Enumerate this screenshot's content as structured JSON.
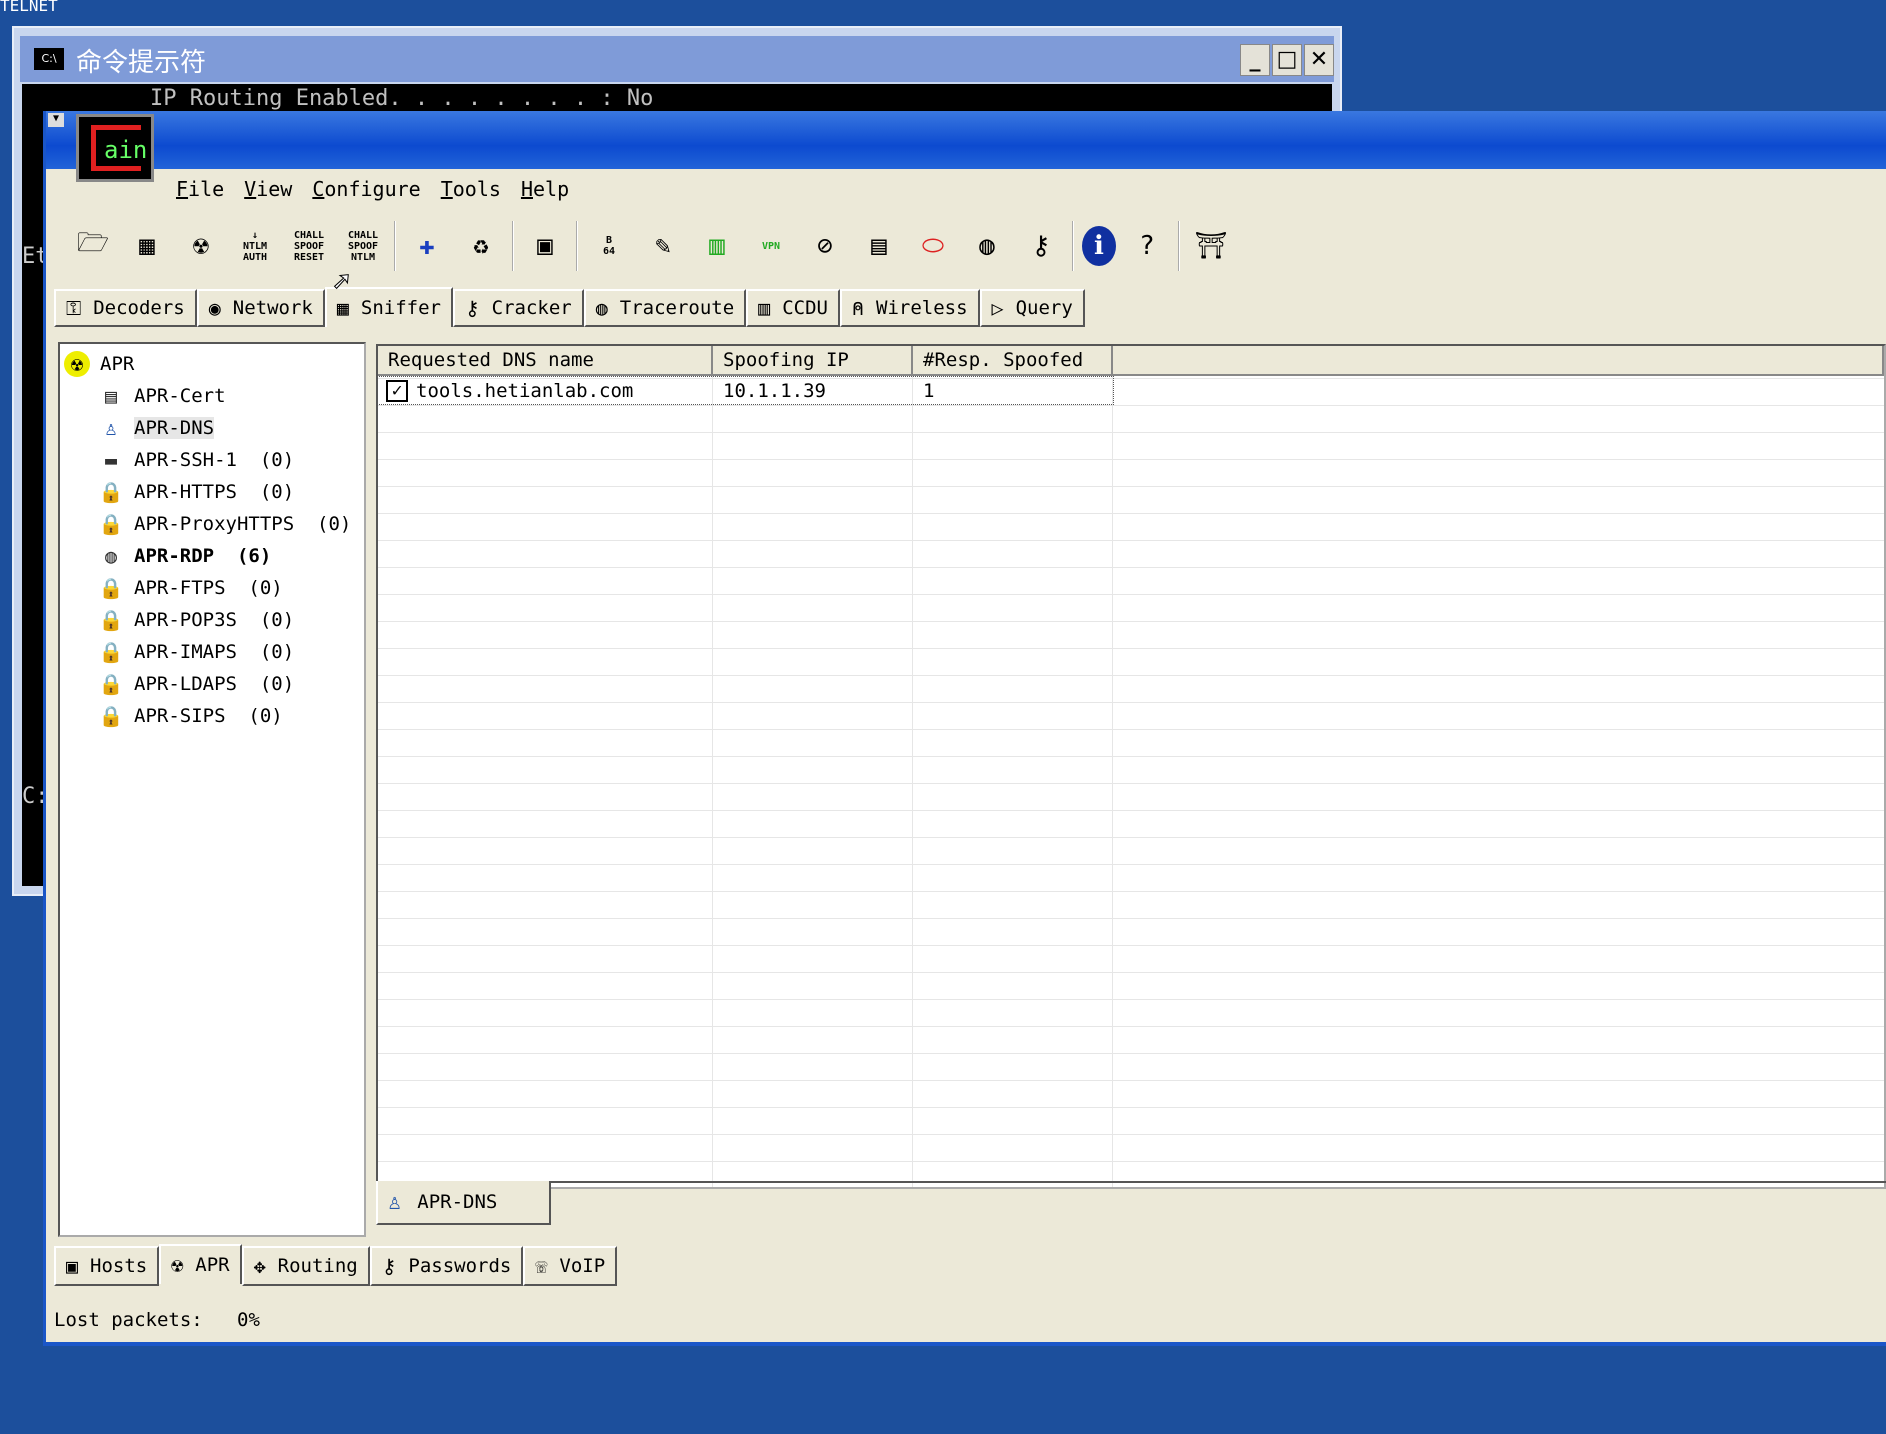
{
  "background_window": {
    "label": "TELNET"
  },
  "cmd_window": {
    "title": "命令提示符",
    "icon": "C:\\",
    "line": "IP Routing Enabled. . . . . . . . : No",
    "side_text_1": "Et",
    "side_text_2": "C:"
  },
  "cain": {
    "logo_text": "ain",
    "menu": [
      "File",
      "View",
      "Configure",
      "Tools",
      "Help"
    ],
    "toolbar": [
      {
        "icon": "folder-icon",
        "glyph": "🗁"
      },
      {
        "icon": "sniffer-icon",
        "glyph": "▦"
      },
      {
        "icon": "apr-icon",
        "glyph": "☢"
      },
      {
        "icon": "ntlm-auth-icon",
        "text": "↓\nNTLM\nAUTH"
      },
      {
        "icon": "chall-spoof-reset-icon",
        "text": "CHALL\nSPOOF\nRESET"
      },
      {
        "icon": "chall-spoof-ntlm-icon",
        "text": "CHALL\nSPOOF\nNTLM"
      },
      {
        "icon": "add-icon",
        "glyph": "✚"
      },
      {
        "icon": "recycle-icon",
        "glyph": "♻"
      },
      {
        "icon": "network-card-icon",
        "glyph": "▣"
      },
      {
        "icon": "base64-icon",
        "text": "B\n64"
      },
      {
        "icon": "key-icon",
        "glyph": "✎"
      },
      {
        "icon": "chart-icon",
        "glyph": "▥"
      },
      {
        "icon": "vpn-icon",
        "text": "VPN"
      },
      {
        "icon": "no-icon",
        "glyph": "⊘"
      },
      {
        "icon": "calculator-icon",
        "glyph": "▤"
      },
      {
        "icon": "capsule-icon",
        "glyph": "⬭"
      },
      {
        "icon": "globe-icon",
        "glyph": "◍"
      },
      {
        "icon": "wrench-icon",
        "glyph": "⚷"
      },
      {
        "icon": "info-icon",
        "glyph": "ℹ"
      },
      {
        "icon": "help-icon",
        "glyph": "?"
      },
      {
        "icon": "exit-icon",
        "glyph": "⛩"
      }
    ],
    "tabs": [
      {
        "label": "Decoders",
        "icon": "decoders-icon",
        "glyph": "⚿"
      },
      {
        "label": "Network",
        "icon": "network-icon",
        "glyph": "◉"
      },
      {
        "label": "Sniffer",
        "icon": "sniffer-icon",
        "glyph": "▦",
        "active": true
      },
      {
        "label": "Cracker",
        "icon": "cracker-icon",
        "glyph": "⚷"
      },
      {
        "label": "Traceroute",
        "icon": "traceroute-icon",
        "glyph": "◍"
      },
      {
        "label": "CCDU",
        "icon": "ccdu-icon",
        "glyph": "▥"
      },
      {
        "label": "Wireless",
        "icon": "wireless-icon",
        "glyph": "⍝"
      },
      {
        "label": "Query",
        "icon": "query-icon",
        "glyph": "▷"
      }
    ],
    "tree": {
      "root": "APR",
      "items": [
        {
          "label": "APR-Cert",
          "icon": "certificate-icon",
          "glyph": "▤"
        },
        {
          "label": "APR-DNS",
          "icon": "dns-icon",
          "glyph": "♙",
          "selected": true
        },
        {
          "label": "APR-SSH-1  (0)",
          "icon": "terminal-icon",
          "glyph": "▬"
        },
        {
          "label": "APR-HTTPS  (0)",
          "icon": "lock-icon",
          "glyph": "🔒"
        },
        {
          "label": "APR-ProxyHTTPS  (0)",
          "icon": "lock-icon",
          "glyph": "🔒"
        },
        {
          "label": "APR-RDP  (6)",
          "icon": "rdp-icon",
          "glyph": "◍",
          "bold": true
        },
        {
          "label": "APR-FTPS  (0)",
          "icon": "lock-icon",
          "glyph": "🔒"
        },
        {
          "label": "APR-POP3S  (0)",
          "icon": "lock-icon",
          "glyph": "🔒"
        },
        {
          "label": "APR-IMAPS  (0)",
          "icon": "lock-icon",
          "glyph": "🔒"
        },
        {
          "label": "APR-LDAPS  (0)",
          "icon": "lock-icon",
          "glyph": "🔒"
        },
        {
          "label": "APR-SIPS  (0)",
          "icon": "lock-icon",
          "glyph": "🔒"
        }
      ]
    },
    "table": {
      "columns": [
        "Requested DNS name",
        "Spoofing IP",
        "#Resp. Spoofed"
      ],
      "rows": [
        {
          "checked": true,
          "name": "tools.hetianlab.com",
          "ip": "10.1.1.39",
          "spoofed": "1"
        }
      ]
    },
    "subtab": "APR-DNS",
    "bottom_tabs": [
      {
        "label": "Hosts",
        "glyph": "▣"
      },
      {
        "label": "APR",
        "glyph": "☢",
        "active": true
      },
      {
        "label": "Routing",
        "glyph": "✥"
      },
      {
        "label": "Passwords",
        "glyph": "⚷"
      },
      {
        "label": "VoIP",
        "glyph": "☏"
      }
    ],
    "status": {
      "label": "Lost packets:",
      "value": "0%"
    }
  }
}
